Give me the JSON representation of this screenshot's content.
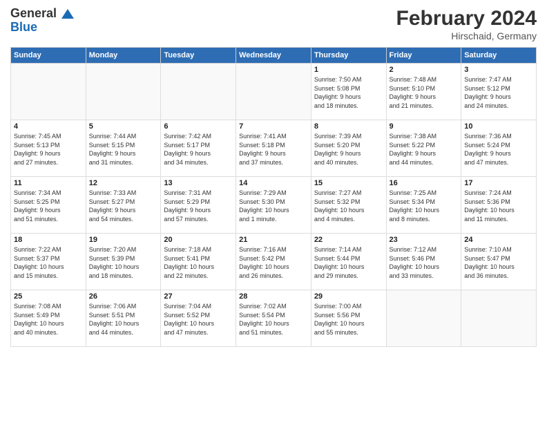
{
  "logo": {
    "line1": "General",
    "line2": "Blue"
  },
  "header": {
    "title": "February 2024",
    "location": "Hirschaid, Germany"
  },
  "days_of_week": [
    "Sunday",
    "Monday",
    "Tuesday",
    "Wednesday",
    "Thursday",
    "Friday",
    "Saturday"
  ],
  "weeks": [
    [
      {
        "day": "",
        "info": ""
      },
      {
        "day": "",
        "info": ""
      },
      {
        "day": "",
        "info": ""
      },
      {
        "day": "",
        "info": ""
      },
      {
        "day": "1",
        "info": "Sunrise: 7:50 AM\nSunset: 5:08 PM\nDaylight: 9 hours\nand 18 minutes."
      },
      {
        "day": "2",
        "info": "Sunrise: 7:48 AM\nSunset: 5:10 PM\nDaylight: 9 hours\nand 21 minutes."
      },
      {
        "day": "3",
        "info": "Sunrise: 7:47 AM\nSunset: 5:12 PM\nDaylight: 9 hours\nand 24 minutes."
      }
    ],
    [
      {
        "day": "4",
        "info": "Sunrise: 7:45 AM\nSunset: 5:13 PM\nDaylight: 9 hours\nand 27 minutes."
      },
      {
        "day": "5",
        "info": "Sunrise: 7:44 AM\nSunset: 5:15 PM\nDaylight: 9 hours\nand 31 minutes."
      },
      {
        "day": "6",
        "info": "Sunrise: 7:42 AM\nSunset: 5:17 PM\nDaylight: 9 hours\nand 34 minutes."
      },
      {
        "day": "7",
        "info": "Sunrise: 7:41 AM\nSunset: 5:18 PM\nDaylight: 9 hours\nand 37 minutes."
      },
      {
        "day": "8",
        "info": "Sunrise: 7:39 AM\nSunset: 5:20 PM\nDaylight: 9 hours\nand 40 minutes."
      },
      {
        "day": "9",
        "info": "Sunrise: 7:38 AM\nSunset: 5:22 PM\nDaylight: 9 hours\nand 44 minutes."
      },
      {
        "day": "10",
        "info": "Sunrise: 7:36 AM\nSunset: 5:24 PM\nDaylight: 9 hours\nand 47 minutes."
      }
    ],
    [
      {
        "day": "11",
        "info": "Sunrise: 7:34 AM\nSunset: 5:25 PM\nDaylight: 9 hours\nand 51 minutes."
      },
      {
        "day": "12",
        "info": "Sunrise: 7:33 AM\nSunset: 5:27 PM\nDaylight: 9 hours\nand 54 minutes."
      },
      {
        "day": "13",
        "info": "Sunrise: 7:31 AM\nSunset: 5:29 PM\nDaylight: 9 hours\nand 57 minutes."
      },
      {
        "day": "14",
        "info": "Sunrise: 7:29 AM\nSunset: 5:30 PM\nDaylight: 10 hours\nand 1 minute."
      },
      {
        "day": "15",
        "info": "Sunrise: 7:27 AM\nSunset: 5:32 PM\nDaylight: 10 hours\nand 4 minutes."
      },
      {
        "day": "16",
        "info": "Sunrise: 7:25 AM\nSunset: 5:34 PM\nDaylight: 10 hours\nand 8 minutes."
      },
      {
        "day": "17",
        "info": "Sunrise: 7:24 AM\nSunset: 5:36 PM\nDaylight: 10 hours\nand 11 minutes."
      }
    ],
    [
      {
        "day": "18",
        "info": "Sunrise: 7:22 AM\nSunset: 5:37 PM\nDaylight: 10 hours\nand 15 minutes."
      },
      {
        "day": "19",
        "info": "Sunrise: 7:20 AM\nSunset: 5:39 PM\nDaylight: 10 hours\nand 18 minutes."
      },
      {
        "day": "20",
        "info": "Sunrise: 7:18 AM\nSunset: 5:41 PM\nDaylight: 10 hours\nand 22 minutes."
      },
      {
        "day": "21",
        "info": "Sunrise: 7:16 AM\nSunset: 5:42 PM\nDaylight: 10 hours\nand 26 minutes."
      },
      {
        "day": "22",
        "info": "Sunrise: 7:14 AM\nSunset: 5:44 PM\nDaylight: 10 hours\nand 29 minutes."
      },
      {
        "day": "23",
        "info": "Sunrise: 7:12 AM\nSunset: 5:46 PM\nDaylight: 10 hours\nand 33 minutes."
      },
      {
        "day": "24",
        "info": "Sunrise: 7:10 AM\nSunset: 5:47 PM\nDaylight: 10 hours\nand 36 minutes."
      }
    ],
    [
      {
        "day": "25",
        "info": "Sunrise: 7:08 AM\nSunset: 5:49 PM\nDaylight: 10 hours\nand 40 minutes."
      },
      {
        "day": "26",
        "info": "Sunrise: 7:06 AM\nSunset: 5:51 PM\nDaylight: 10 hours\nand 44 minutes."
      },
      {
        "day": "27",
        "info": "Sunrise: 7:04 AM\nSunset: 5:52 PM\nDaylight: 10 hours\nand 47 minutes."
      },
      {
        "day": "28",
        "info": "Sunrise: 7:02 AM\nSunset: 5:54 PM\nDaylight: 10 hours\nand 51 minutes."
      },
      {
        "day": "29",
        "info": "Sunrise: 7:00 AM\nSunset: 5:56 PM\nDaylight: 10 hours\nand 55 minutes."
      },
      {
        "day": "",
        "info": ""
      },
      {
        "day": "",
        "info": ""
      }
    ]
  ]
}
